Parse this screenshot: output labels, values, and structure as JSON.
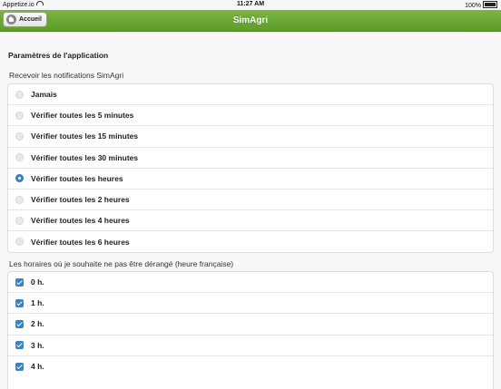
{
  "status_bar": {
    "carrier": "Appetize.io",
    "time": "11:27 AM",
    "battery": "100%"
  },
  "nav": {
    "back_label": "Accueil",
    "title": "SimAgri"
  },
  "settings": {
    "section_title": "Paramètres de l'application",
    "notifications_label": "Recevoir les notifications SimAgri",
    "notification_options": [
      {
        "label": "Jamais",
        "selected": false
      },
      {
        "label": "Vérifier toutes les 5 minutes",
        "selected": false
      },
      {
        "label": "Vérifier toutes les 15 minutes",
        "selected": false
      },
      {
        "label": "Vérifier toutes les 30 minutes",
        "selected": false
      },
      {
        "label": "Vérifier toutes les heures",
        "selected": true
      },
      {
        "label": "Vérifier toutes les 2 heures",
        "selected": false
      },
      {
        "label": "Vérifier toutes les 4 heures",
        "selected": false
      },
      {
        "label": "Vérifier toutes les 6 heures",
        "selected": false
      }
    ],
    "quiet_hours_label": "Les horaires où je souhaite ne pas être dérangé (heure française)",
    "quiet_hours": [
      {
        "label": "0 h.",
        "checked": true
      },
      {
        "label": "1 h.",
        "checked": true
      },
      {
        "label": "2 h.",
        "checked": true
      },
      {
        "label": "3 h.",
        "checked": true
      },
      {
        "label": "4 h.",
        "checked": true
      }
    ]
  },
  "colors": {
    "nav_green": "#6aa936",
    "accent_blue": "#3584c9"
  }
}
